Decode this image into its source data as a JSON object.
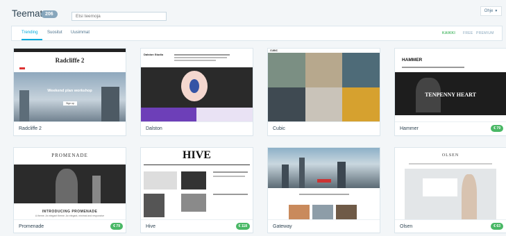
{
  "header": {
    "title": "Teemat",
    "count": "206",
    "search_placeholder": "Etsi teemoja",
    "help_label": "Ohje"
  },
  "tabs": [
    {
      "label": "Trending"
    },
    {
      "label": "Suositut"
    },
    {
      "label": "Uusimmat"
    }
  ],
  "filters": [
    {
      "label": "KAIKKI"
    },
    {
      "label": "FREE"
    },
    {
      "label": "PREMIUM"
    }
  ],
  "themes": [
    {
      "name": "Radcliffe 2",
      "price": "",
      "shot": {
        "heading": "Radcliffe 2",
        "hero_text": "Weekend plan workshop",
        "button": "Sign up"
      }
    },
    {
      "name": "Dalston",
      "price": "",
      "shot": {
        "heading": "Dalston Studio"
      }
    },
    {
      "name": "Cubic",
      "price": "",
      "shot": {
        "heading": "CUBIC"
      }
    },
    {
      "name": "Hammer",
      "price": "€ 79",
      "shot": {
        "heading": "HAMMER",
        "hero_text": "TENPENNY HEART"
      }
    },
    {
      "name": "Promenade",
      "price": "€ 79",
      "shot": {
        "heading": "PROMENADE",
        "hero_text": "INTRODUCING PROMENADE",
        "tagline": "A theme. An elegant theme. An elegant, minimal and responsive"
      }
    },
    {
      "name": "Hive",
      "price": "€ 118",
      "shot": {
        "heading": "HIVE"
      }
    },
    {
      "name": "Gateway",
      "price": "",
      "shot": {
        "heading": ""
      }
    },
    {
      "name": "Olsen",
      "price": "€ 63",
      "shot": {
        "heading": "OLSEN"
      }
    }
  ]
}
